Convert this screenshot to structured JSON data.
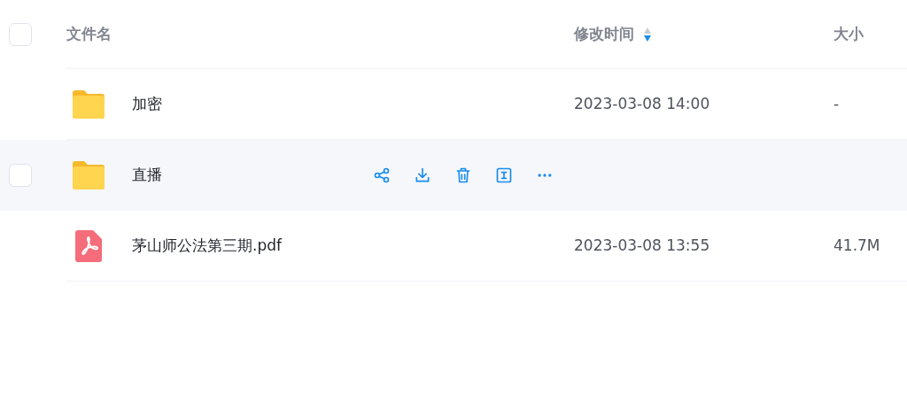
{
  "header": {
    "checked": false,
    "name": "文件名",
    "modified": "修改时间",
    "sort_descending": true,
    "size": "大小"
  },
  "rows": [
    {
      "kind": "folder",
      "name": "加密",
      "modified": "2023-03-08 14:00",
      "size": "-",
      "hovered": false
    },
    {
      "kind": "folder",
      "name": "直播",
      "hovered": true,
      "checked": false,
      "actions": [
        {
          "kind": "share"
        },
        {
          "kind": "download"
        },
        {
          "kind": "delete"
        },
        {
          "kind": "rename"
        },
        {
          "kind": "more"
        }
      ]
    },
    {
      "kind": "pdf",
      "name": "茅山师公法第三期.pdf",
      "modified": "2023-03-08 13:55",
      "size": "41.7M",
      "hovered": false
    }
  ]
}
